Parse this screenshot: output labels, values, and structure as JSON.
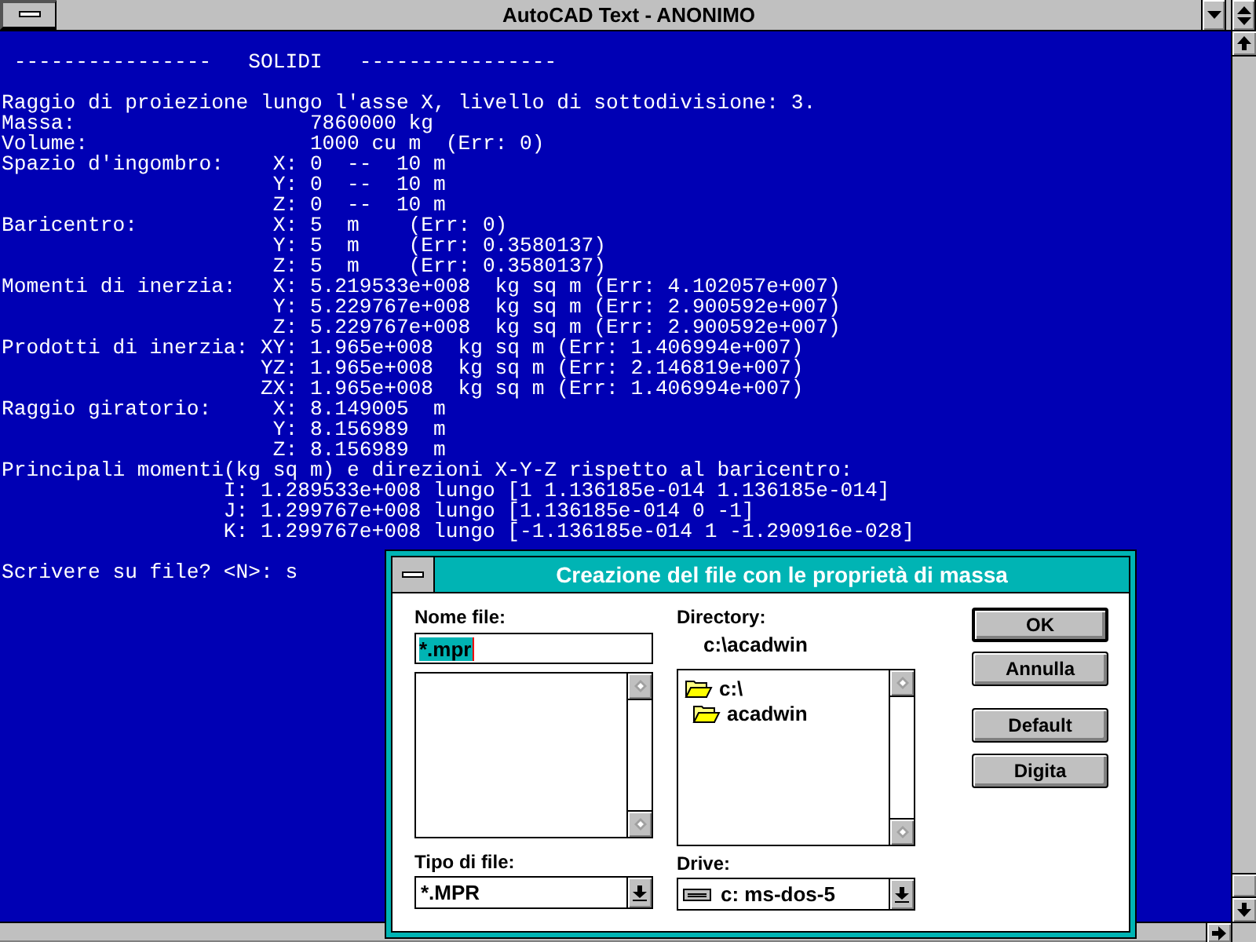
{
  "window": {
    "title": "AutoCAD Text - ANONIMO"
  },
  "console": {
    "header": "----------------   SOLIDI   ----------------",
    "lines": [
      "Raggio di proiezione lungo l'asse X, livello di sottodivisione: 3.",
      "Massa:                   7860000 kg",
      "Volume:                  1000 cu m  (Err: 0)",
      "Spazio d'ingombro:    X: 0  --  10 m",
      "                      Y: 0  --  10 m",
      "                      Z: 0  --  10 m",
      "Baricentro:           X: 5  m    (Err: 0)",
      "                      Y: 5  m    (Err: 0.3580137)",
      "                      Z: 5  m    (Err: 0.3580137)",
      "Momenti di inerzia:   X: 5.219533e+008  kg sq m (Err: 4.102057e+007)",
      "                      Y: 5.229767e+008  kg sq m (Err: 2.900592e+007)",
      "                      Z: 5.229767e+008  kg sq m (Err: 2.900592e+007)",
      "Prodotti di inerzia: XY: 1.965e+008  kg sq m (Err: 1.406994e+007)",
      "                     YZ: 1.965e+008  kg sq m (Err: 2.146819e+007)",
      "                     ZX: 1.965e+008  kg sq m (Err: 1.406994e+007)",
      "Raggio giratorio:     X: 8.149005  m",
      "                      Y: 8.156989  m",
      "                      Z: 8.156989  m",
      "Principali momenti(kg sq m) e direzioni X-Y-Z rispetto al baricentro:",
      "                  I: 1.289533e+008 lungo [1 1.136185e-014 1.136185e-014]",
      "                  J: 1.299767e+008 lungo [1.136185e-014 0 -1]",
      "                  K: 1.299767e+008 lungo [-1.136185e-014 1 -1.290916e-028]"
    ],
    "prompt": "Scrivere su file? <N>: s"
  },
  "dialog": {
    "title": "Creazione del file con le proprietà di massa",
    "file_name": {
      "label": "Nome file:",
      "value": "*.mpr"
    },
    "directory": {
      "label": "Directory:",
      "path": "c:\\acadwin",
      "items": [
        {
          "label": "c:\\",
          "children": [
            {
              "label": "acadwin"
            }
          ]
        }
      ]
    },
    "file_type": {
      "label": "Tipo di file:",
      "value": "*.MPR"
    },
    "drive": {
      "label": "Drive:",
      "value": "c: ms-dos-5"
    },
    "buttons": [
      {
        "label": "OK",
        "default": true
      },
      {
        "label": "Annulla",
        "default": false
      },
      {
        "label": "Default",
        "default": false
      },
      {
        "label": "Digita",
        "default": false
      }
    ]
  }
}
